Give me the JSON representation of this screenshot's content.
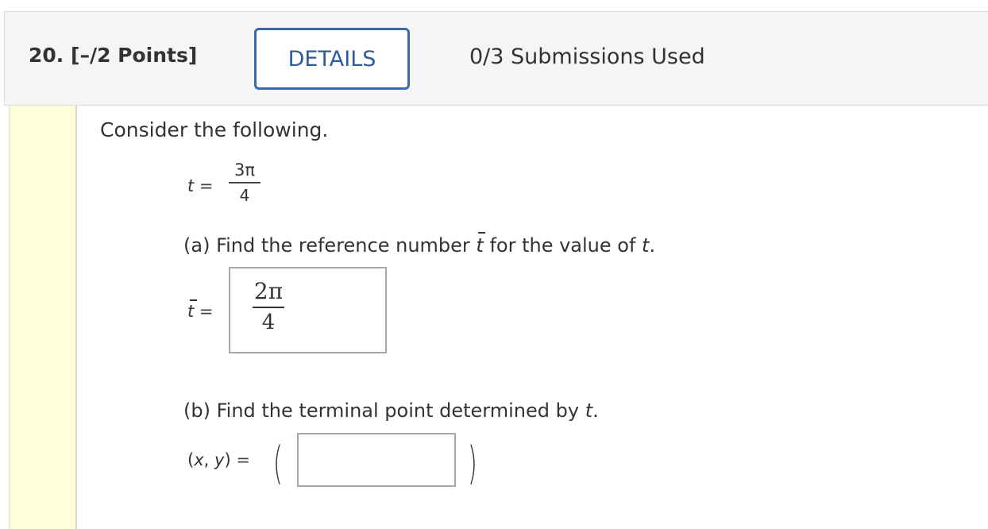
{
  "header": {
    "question_number": "20.",
    "points": "[–/2 Points]",
    "details_label": "DETAILS",
    "submissions": "0/3 Submissions Used"
  },
  "problem": {
    "intro": "Consider the following.",
    "t_var": "t",
    "equals": "=",
    "t_numerator": "3π",
    "t_denominator": "4",
    "part_a": {
      "prefix": "(a) Find the reference number ",
      "tbar": "t",
      "middle": " for the value of ",
      "t": "t",
      "suffix": "."
    },
    "answer_a": {
      "lhs_var": "t",
      "equals": "=",
      "numerator": "2π",
      "denominator": "4"
    },
    "part_b": {
      "prefix": "(b) Find the terminal point determined by ",
      "t": "t",
      "suffix": "."
    },
    "answer_b": {
      "lhs_open": "(",
      "x": "x",
      "comma": ", ",
      "y": "y",
      "lhs_close": ")",
      "equals": "=",
      "open_paren": "(",
      "close_paren": ")",
      "value": ""
    }
  },
  "colors": {
    "details_border": "#3a6aa8",
    "details_text": "#2a5d9f",
    "sidebar": "#fefed8",
    "header_bg": "#f5f5f5"
  }
}
